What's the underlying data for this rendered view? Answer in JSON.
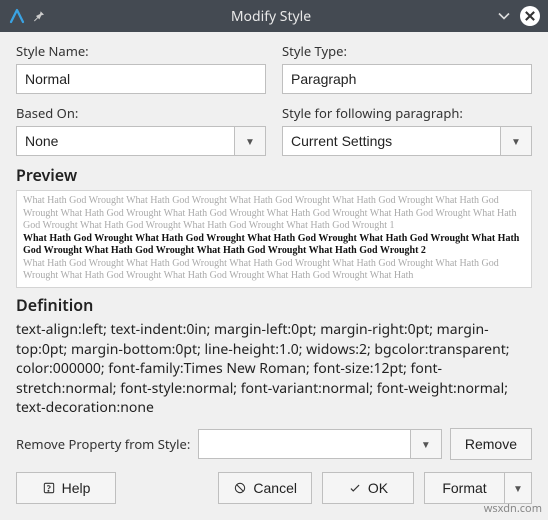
{
  "window": {
    "title": "Modify Style"
  },
  "labels": {
    "styleName": "Style Name:",
    "styleType": "Style Type:",
    "basedOn": "Based On:",
    "nextStyle": "Style for following paragraph:",
    "previewHead": "Preview",
    "definitionHead": "Definition",
    "removeProp": "Remove Property from Style:"
  },
  "fields": {
    "styleName": "Normal",
    "styleType": "Paragraph",
    "basedOn": "None",
    "nextStyle": "Current Settings",
    "removeProp": ""
  },
  "preview": {
    "light1": "What Hath God Wrought  What Hath God Wrought  What Hath God Wrought  What Hath God Wrought  What Hath God Wrought  What Hath God Wrought  What Hath God Wrought  What Hath God Wrought  What Hath God Wrought  What Hath God Wrought  What Hath God Wrought  What Hath God Wrought  What Hath God Wrought  1",
    "bold": "What Hath God Wrought  What Hath God Wrought  What Hath God Wrought  What Hath God Wrought  What Hath God Wrought  What Hath God Wrought  What Hath God Wrought  What Hath God Wrought  2",
    "light2": "What Hath God Wrought  What Hath God Wrought  What Hath God Wrought  What Hath God Wrought  What Hath God Wrought  What Hath God Wrought  What Hath God Wrought  What Hath God Wrought  What Hath"
  },
  "definition": "text-align:left; text-indent:0in; margin-left:0pt; margin-right:0pt; margin-top:0pt; margin-bottom:0pt; line-height:1.0; widows:2; bgcolor:transparent; color:000000; font-family:Times New Roman; font-size:12pt; font-stretch:normal; font-style:normal; font-variant:normal; font-weight:normal; text-decoration:none",
  "buttons": {
    "remove": "Remove",
    "help": "Help",
    "cancel": "Cancel",
    "ok": "OK",
    "format": "Format"
  },
  "watermark": "wsxdn.com"
}
